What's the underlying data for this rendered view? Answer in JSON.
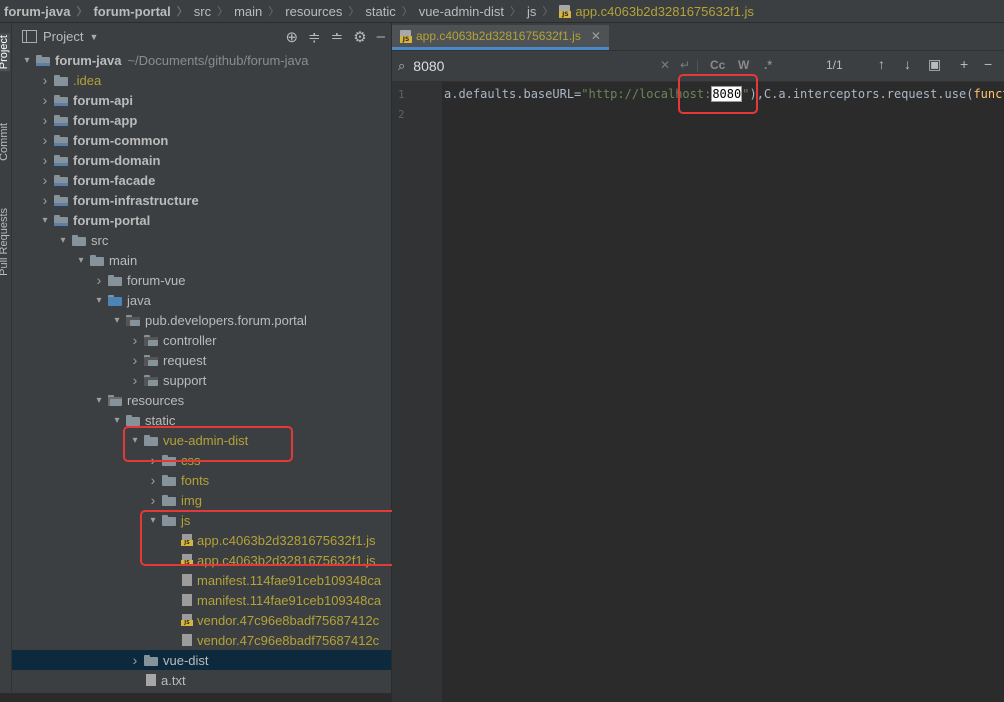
{
  "breadcrumb": {
    "items": [
      "forum-java",
      "forum-portal",
      "src",
      "main",
      "resources",
      "static",
      "vue-admin-dist",
      "js"
    ],
    "file": "app.c4063b2d3281675632f1.js"
  },
  "toolstrip": {
    "project": "Project",
    "commit": "Commit",
    "pull_requests": "Pull Requests"
  },
  "project_panel": {
    "title": "Project",
    "tools": [
      "target-icon",
      "expand-icon",
      "collapse-icon",
      "gear-icon",
      "minimize-icon"
    ]
  },
  "tree": [
    {
      "label": "forum-java",
      "path": "~/Documents/github/forum-java",
      "depth": 0,
      "arrow": "down",
      "icon": "module",
      "style": "bold"
    },
    {
      "label": ".idea",
      "depth": 1,
      "arrow": "right",
      "icon": "folder",
      "style": "idea"
    },
    {
      "label": "forum-api",
      "depth": 1,
      "arrow": "right",
      "icon": "module",
      "style": "bold"
    },
    {
      "label": "forum-app",
      "depth": 1,
      "arrow": "right",
      "icon": "module",
      "style": "bold"
    },
    {
      "label": "forum-common",
      "depth": 1,
      "arrow": "right",
      "icon": "module",
      "style": "bold"
    },
    {
      "label": "forum-domain",
      "depth": 1,
      "arrow": "right",
      "icon": "module",
      "style": "bold"
    },
    {
      "label": "forum-facade",
      "depth": 1,
      "arrow": "right",
      "icon": "module",
      "style": "bold"
    },
    {
      "label": "forum-infrastructure",
      "depth": 1,
      "arrow": "right",
      "icon": "module",
      "style": "bold"
    },
    {
      "label": "forum-portal",
      "depth": 1,
      "arrow": "down",
      "icon": "module",
      "style": "bold"
    },
    {
      "label": "src",
      "depth": 2,
      "arrow": "down",
      "icon": "folder",
      "style": "normal"
    },
    {
      "label": "main",
      "depth": 3,
      "arrow": "down",
      "icon": "folder",
      "style": "normal"
    },
    {
      "label": "forum-vue",
      "depth": 4,
      "arrow": "right",
      "icon": "folder",
      "style": "normal"
    },
    {
      "label": "java",
      "depth": 4,
      "arrow": "down",
      "icon": "src",
      "style": "normal"
    },
    {
      "label": "pub.developers.forum.portal",
      "depth": 5,
      "arrow": "down",
      "icon": "pkg",
      "style": "normal"
    },
    {
      "label": "controller",
      "depth": 6,
      "arrow": "right",
      "icon": "pkg",
      "style": "normal"
    },
    {
      "label": "request",
      "depth": 6,
      "arrow": "right",
      "icon": "pkg",
      "style": "normal"
    },
    {
      "label": "support",
      "depth": 6,
      "arrow": "right",
      "icon": "pkg",
      "style": "normal"
    },
    {
      "label": "resources",
      "depth": 4,
      "arrow": "down",
      "icon": "res",
      "style": "normal"
    },
    {
      "label": "static",
      "depth": 5,
      "arrow": "down",
      "icon": "folder",
      "style": "normal"
    },
    {
      "label": "vue-admin-dist",
      "depth": 6,
      "arrow": "down",
      "icon": "folder",
      "style": "yellow"
    },
    {
      "label": "css",
      "depth": 7,
      "arrow": "right",
      "icon": "folder",
      "style": "yellow"
    },
    {
      "label": "fonts",
      "depth": 7,
      "arrow": "right",
      "icon": "folder",
      "style": "yellow"
    },
    {
      "label": "img",
      "depth": 7,
      "arrow": "right",
      "icon": "folder",
      "style": "yellow"
    },
    {
      "label": "js",
      "depth": 7,
      "arrow": "down",
      "icon": "folder",
      "style": "yellow"
    },
    {
      "label": "app.c4063b2d3281675632f1.js",
      "depth": 8,
      "arrow": "none",
      "icon": "js",
      "style": "yellow"
    },
    {
      "label": "app.c4063b2d3281675632f1.js",
      "depth": 8,
      "arrow": "none",
      "icon": "js",
      "style": "yellow"
    },
    {
      "label": "manifest.114fae91ceb109348ca",
      "depth": 8,
      "arrow": "none",
      "icon": "file",
      "style": "yellow"
    },
    {
      "label": "manifest.114fae91ceb109348ca",
      "depth": 8,
      "arrow": "none",
      "icon": "file",
      "style": "yellow"
    },
    {
      "label": "vendor.47c96e8badf75687412c",
      "depth": 8,
      "arrow": "none",
      "icon": "js",
      "style": "yellow"
    },
    {
      "label": "vendor.47c96e8badf75687412c",
      "depth": 8,
      "arrow": "none",
      "icon": "file",
      "style": "yellow"
    },
    {
      "label": "vue-dist",
      "depth": 6,
      "arrow": "right",
      "icon": "folder",
      "style": "normal",
      "selected": true
    },
    {
      "label": "a.txt",
      "depth": 6,
      "arrow": "none",
      "icon": "txt",
      "style": "normal"
    }
  ],
  "editor": {
    "tab_label": "app.c4063b2d3281675632f1.js",
    "find": {
      "query": "8080",
      "match_count": "1/1",
      "options": [
        "Cc",
        "W",
        ".*"
      ]
    },
    "lines": [
      {
        "number": "1",
        "before": "a.defaults.baseURL=",
        "string_pre": "\"http://localhost:",
        "match": "8080",
        "string_post": "\"",
        "after": "),C.a.interceptors.request.use(",
        "fn": "function"
      },
      {
        "number": "2"
      }
    ]
  },
  "colors": {
    "highlight_box": "#e53838",
    "accent": "#4a88c7",
    "dist_text": "#b3a238"
  }
}
